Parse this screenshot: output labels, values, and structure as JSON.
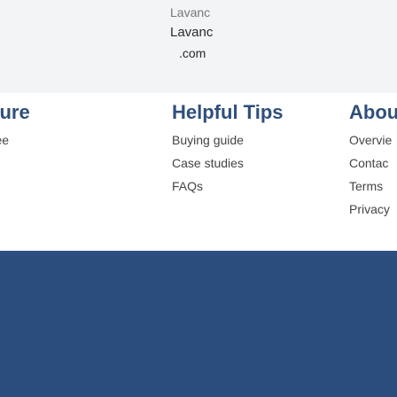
{
  "banner": {
    "line1": "Lavanc",
    "line2": "Lavanc",
    "line3": ".com"
  },
  "columns": {
    "left": {
      "title": "ecure",
      "links": [
        "antee"
      ]
    },
    "middle": {
      "title": "Helpful Tips",
      "links": [
        "Buying guide",
        "Case studies",
        "FAQs"
      ]
    },
    "right": {
      "title": "Abou",
      "links": [
        "Overvie",
        "Contac",
        "Terms",
        "Privacy"
      ]
    }
  },
  "colors": {
    "footer_bg": "#2c4f7f",
    "card_bg": "#ffffff",
    "banner_bg": "#f3f4f6",
    "heading": "#2f4f7a",
    "link": "#444444"
  }
}
